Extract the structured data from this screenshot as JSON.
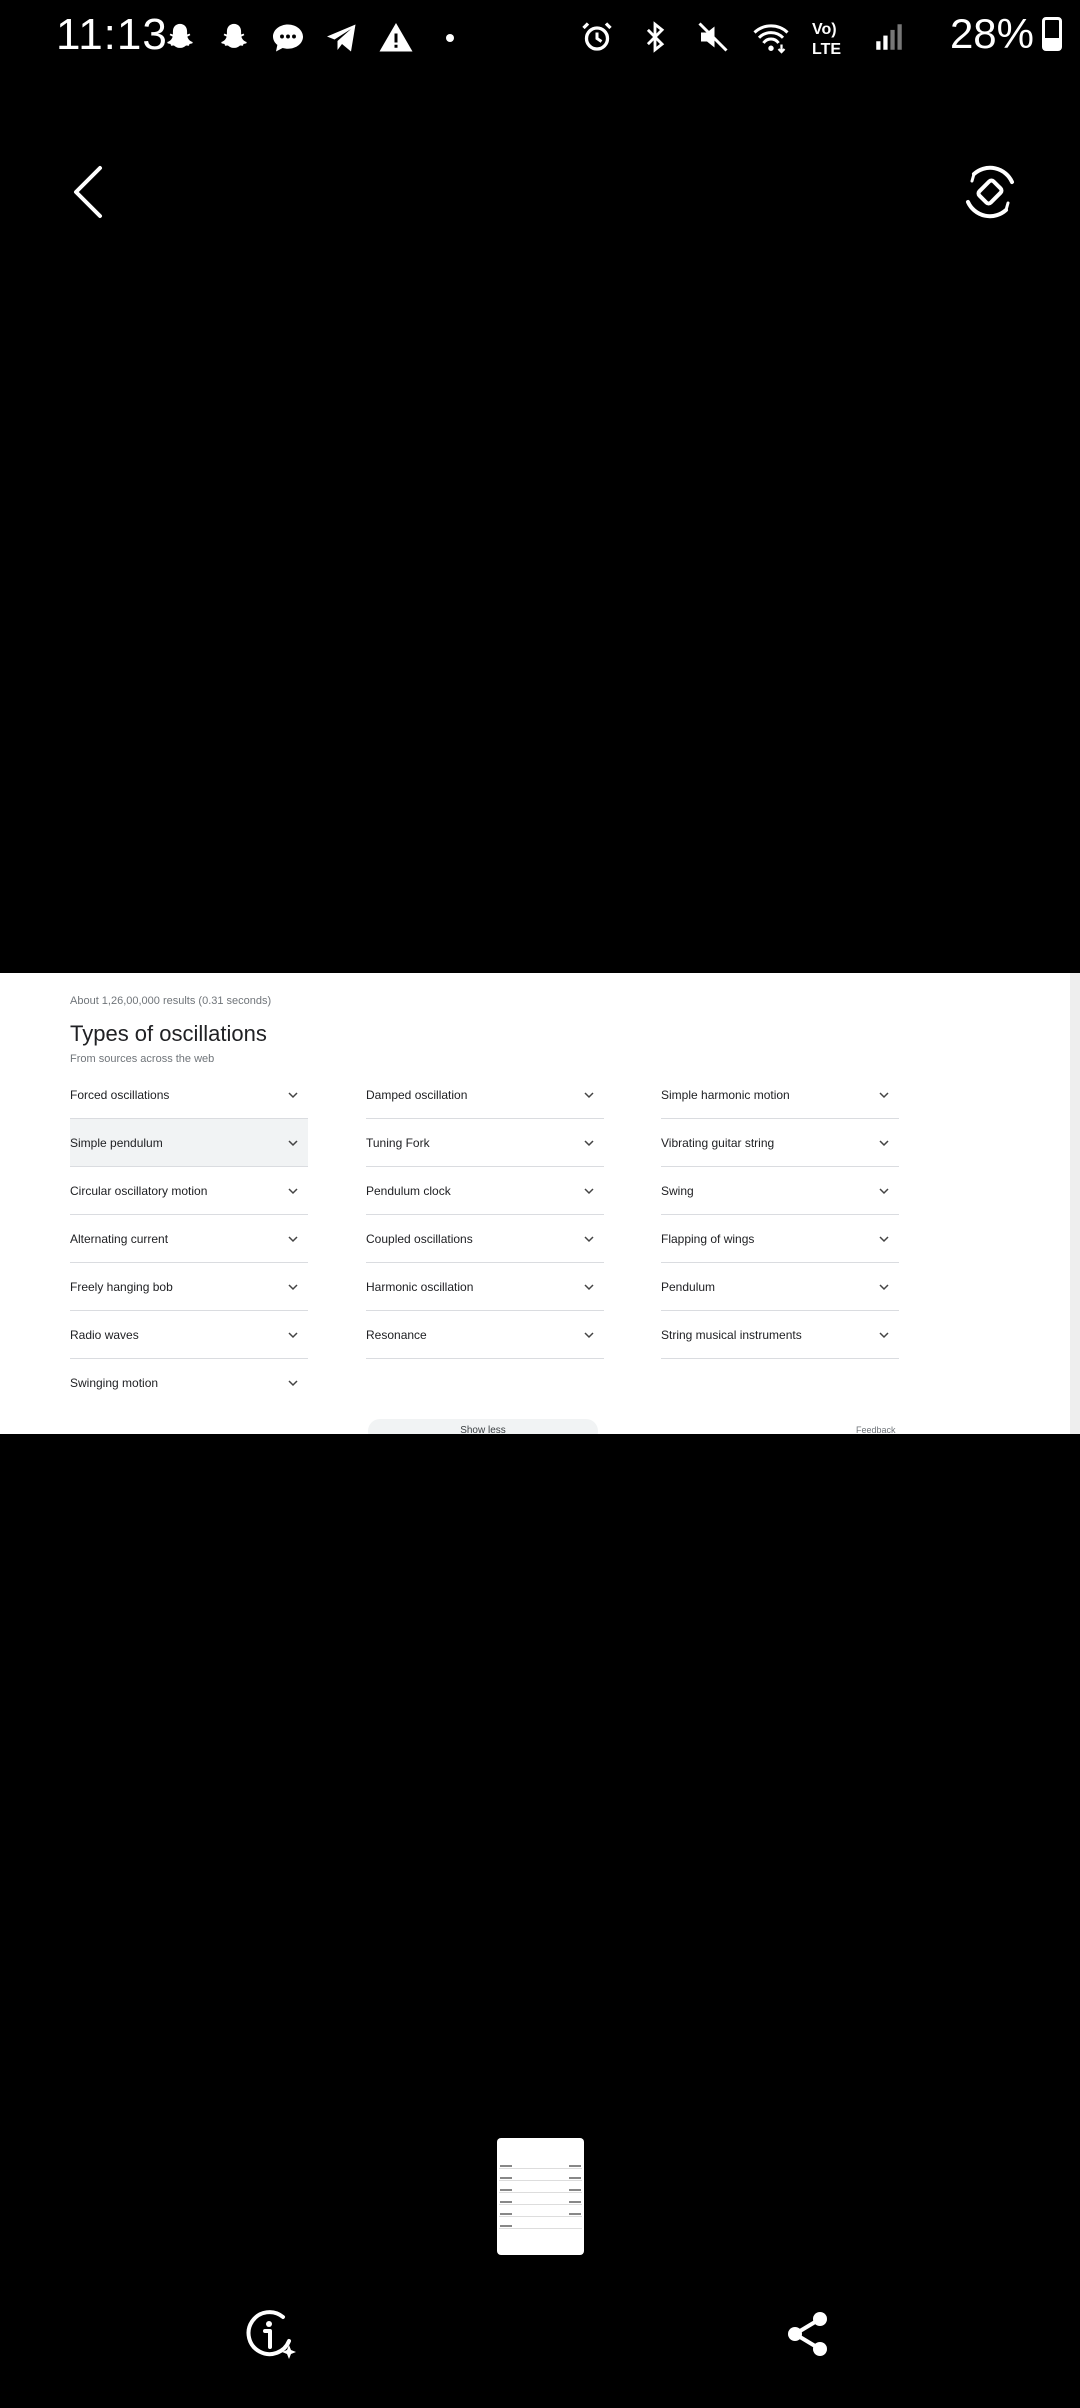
{
  "status_bar": {
    "time": "11:13",
    "battery": "28%",
    "left_icons": [
      "snapchat-icon",
      "snapchat-icon",
      "chat-bubble-icon",
      "telegram-icon",
      "warning-icon",
      "dot-icon"
    ],
    "right_icons": [
      "alarm-icon",
      "bluetooth-icon",
      "mute-icon",
      "wifi-icon",
      "volte-icon",
      "signal-icon",
      "battery-icon"
    ],
    "volte_label": "Vo) LTE"
  },
  "top_actions": {
    "back_icon": "chevron-left-icon",
    "rotate_icon": "rotate-screen-icon"
  },
  "preview": {
    "result_count": "About 1,26,00,000 results (0.31 seconds)",
    "title": "Types of oscillations",
    "subtitle": "From sources across the web",
    "columns": [
      [
        "Forced oscillations",
        "Simple pendulum",
        "Circular oscillatory motion",
        "Alternating current",
        "Freely hanging bob",
        "Radio waves",
        "Swinging motion"
      ],
      [
        "Damped oscillation",
        "Tuning Fork",
        "Pendulum clock",
        "Coupled oscillations",
        "Harmonic oscillation",
        "Resonance"
      ],
      [
        "Simple harmonic motion",
        "Vibrating guitar string",
        "Swing",
        "Flapping of wings",
        "Pendulum",
        "String musical instruments"
      ]
    ],
    "show_less": "Show less",
    "feedback": "Feedback"
  },
  "bottom_actions": {
    "info_icon": "info-sparkle-icon",
    "share_icon": "share-icon"
  }
}
